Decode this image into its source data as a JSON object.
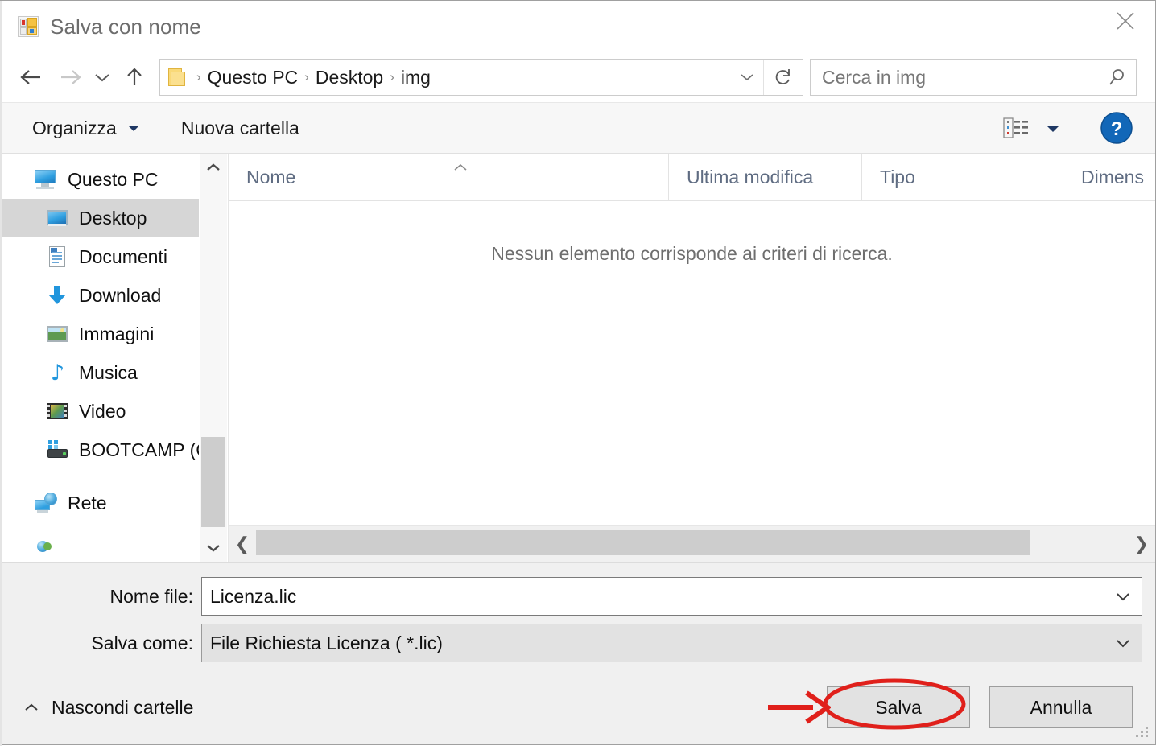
{
  "window": {
    "title": "Salva con nome",
    "icon": "save-as-icon",
    "close_label": "Chiudi"
  },
  "nav": {
    "back_icon": "arrow-left-icon",
    "forward_icon": "arrow-right-icon",
    "history_icon": "chevron-down-icon",
    "up_icon": "arrow-up-icon",
    "breadcrumb": [
      "Questo PC",
      "Desktop",
      "img"
    ],
    "breadcrumb_separator": "›",
    "address_chevron_icon": "chevron-down-icon",
    "refresh_icon": "refresh-icon"
  },
  "search": {
    "placeholder": "Cerca in img",
    "value": "",
    "icon": "search-icon"
  },
  "commandbar": {
    "organize_label": "Organizza",
    "organize_caret_icon": "caret-down-icon",
    "new_folder_label": "Nuova cartella",
    "view_icon": "view-details-icon",
    "view_caret_icon": "caret-down-icon",
    "help_icon": "help-question-icon"
  },
  "navpane": {
    "items": [
      {
        "label": "Questo PC",
        "icon": "this-pc-icon",
        "level": "root",
        "selected": false
      },
      {
        "label": "Desktop",
        "icon": "desktop-icon",
        "level": "child",
        "selected": true
      },
      {
        "label": "Documenti",
        "icon": "documents-icon",
        "level": "child",
        "selected": false
      },
      {
        "label": "Download",
        "icon": "downloads-icon",
        "level": "child",
        "selected": false
      },
      {
        "label": "Immagini",
        "icon": "pictures-icon",
        "level": "child",
        "selected": false
      },
      {
        "label": "Musica",
        "icon": "music-icon",
        "level": "child",
        "selected": false
      },
      {
        "label": "Video",
        "icon": "videos-icon",
        "level": "child",
        "selected": false
      },
      {
        "label": "BOOTCAMP (C:)",
        "icon": "drive-icon",
        "level": "child",
        "selected": false
      },
      {
        "label": "Rete",
        "icon": "network-icon",
        "level": "root",
        "selected": false
      }
    ],
    "scroll_up_icon": "chevron-up-icon",
    "scroll_down_icon": "chevron-down-icon"
  },
  "filelist": {
    "columns": [
      {
        "label": "Nome",
        "sorted": true,
        "sort_icon": "caret-up-icon"
      },
      {
        "label": "Ultima modifica",
        "sorted": false
      },
      {
        "label": "Tipo",
        "sorted": false
      },
      {
        "label": "Dimens",
        "sorted": false
      }
    ],
    "empty_message": "Nessun elemento corrisponde ai criteri di ricerca.",
    "rows": [],
    "hscroll_left_icon": "chevron-left-icon",
    "hscroll_right_icon": "chevron-right-icon"
  },
  "footer": {
    "filename_label": "Nome file:",
    "filename_value": "Licenza.lic",
    "filename_caret_icon": "chevron-down-icon",
    "filetype_label": "Salva come:",
    "filetype_value": "File Richiesta Licenza  ( *.lic)",
    "filetype_caret_icon": "chevron-down-icon",
    "hide_folders_label": "Nascondi cartelle",
    "hide_folders_caret_icon": "chevron-up-icon",
    "save_label": "Salva",
    "cancel_label": "Annulla",
    "resize_grip_icon": "resize-grip-icon"
  },
  "annotations": {
    "highlight_color": "#e0201b",
    "arrow": "arrow-pointing-right-annotation",
    "ellipse": "red-ellipse-annotation-around-save"
  }
}
